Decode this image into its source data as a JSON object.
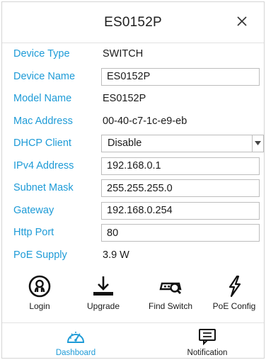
{
  "header": {
    "title": "ES0152P"
  },
  "device": {
    "type": {
      "label": "Device Type",
      "value": "SWITCH"
    },
    "name": {
      "label": "Device Name",
      "value": "ES0152P"
    },
    "model": {
      "label": "Model Name",
      "value": "ES0152P"
    },
    "mac": {
      "label": "Mac Address",
      "value": "00-40-c7-1c-e9-eb"
    },
    "dhcp": {
      "label": "DHCP Client",
      "value": "Disable"
    },
    "ipv4": {
      "label": "IPv4 Address",
      "value": "192.168.0.1"
    },
    "subnet": {
      "label": "Subnet Mask",
      "value": "255.255.255.0"
    },
    "gateway": {
      "label": "Gateway",
      "value": "192.168.0.254"
    },
    "http": {
      "label": "Http Port",
      "value": "80"
    },
    "poe": {
      "label": "PoE Supply",
      "value": "3.9 W"
    }
  },
  "actions": [
    {
      "label": "Login",
      "icon": "login-icon"
    },
    {
      "label": "Upgrade",
      "icon": "upgrade-icon"
    },
    {
      "label": "Find Switch",
      "icon": "find-switch-icon"
    },
    {
      "label": "PoE Config",
      "icon": "poe-config-icon"
    }
  ],
  "tabs": [
    {
      "label": "Dashboard",
      "icon": "dashboard-icon",
      "active": true
    },
    {
      "label": "Notification",
      "icon": "notification-icon",
      "active": false
    }
  ],
  "colors": {
    "label": "#1e9bd7",
    "accent": "#1e9bd7",
    "text": "#1a1a1a"
  }
}
